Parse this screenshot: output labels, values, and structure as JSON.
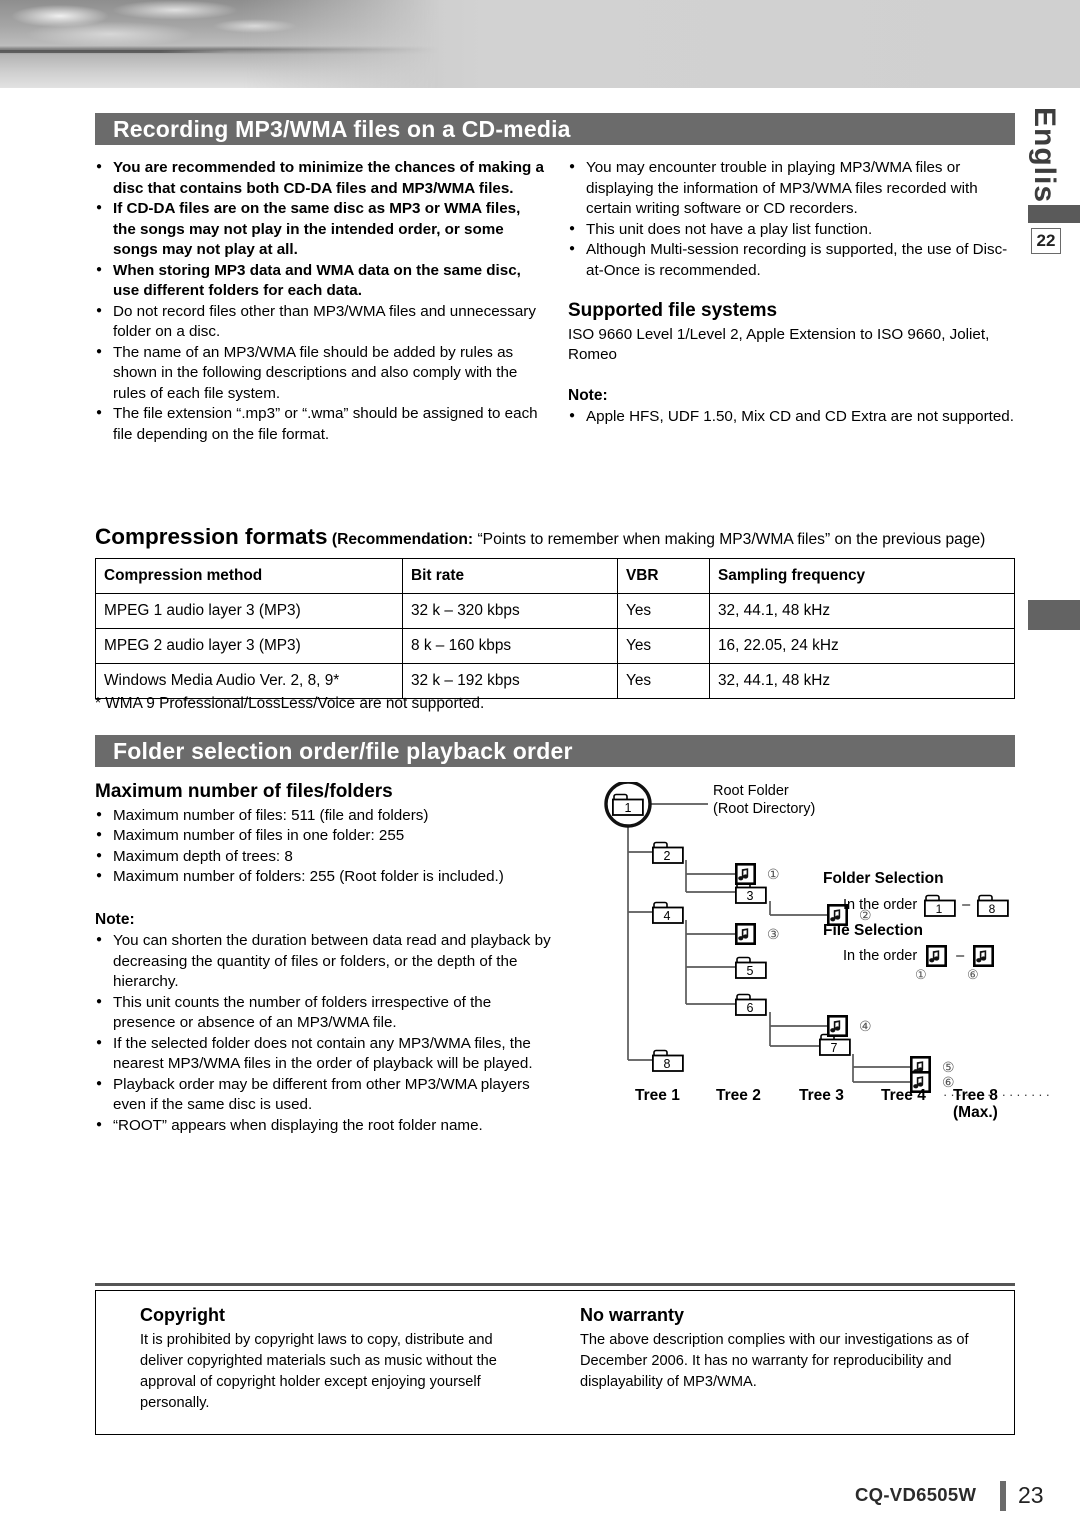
{
  "lang_tab": {
    "label": "English",
    "page_marker": "22"
  },
  "sections": {
    "recording": {
      "title": "Recording MP3/WMA files on a CD-media",
      "left_bullets": [
        {
          "bold": true,
          "text": "You are recommended to minimize the chances of making a disc that contains both CD-DA files and MP3/WMA files."
        },
        {
          "bold": true,
          "text": "If CD-DA files are on the same disc as MP3 or WMA files, the songs may not play in the intended order, or some songs may not play at all."
        },
        {
          "bold": true,
          "text": "When storing MP3 data and WMA data on the same disc, use different folders for each data."
        },
        {
          "bold": false,
          "text": "Do not record files other than MP3/WMA files and unnecessary folder on a disc."
        },
        {
          "bold": false,
          "text": "The name of an MP3/WMA file should be added by rules as shown in the following descriptions and also comply with the rules of each file system."
        },
        {
          "bold": false,
          "text": "The file extension “.mp3” or “.wma” should be assigned to each file depending on the file format."
        }
      ],
      "right_bullets": [
        "You may encounter trouble in playing MP3/WMA files or displaying the information of MP3/WMA files recorded with certain writing software or CD recorders.",
        "This unit does not have a play list function.",
        "Although Multi-session recording is supported, the use of Disc-at-Once is recommended."
      ],
      "supported_heading": "Supported file systems",
      "supported_body": "ISO 9660 Level 1/Level 2, Apple Extension to ISO 9660, Joliet, Romeo",
      "note_heading": "Note:",
      "note_bullets": [
        "Apple HFS, UDF 1.50, Mix CD and CD Extra are not supported."
      ]
    },
    "compression": {
      "heading_main": "Compression formats",
      "heading_sub_bold": "(Recommendation:",
      "heading_sub_rest": " “Points to remember when making MP3/WMA files” on the previous page)",
      "table": {
        "headers": [
          "Compression method",
          "Bit rate",
          "VBR",
          "Sampling frequency"
        ],
        "rows": [
          [
            "MPEG 1 audio layer 3 (MP3)",
            "32 k – 320 kbps",
            "Yes",
            "32, 44.1, 48 kHz"
          ],
          [
            "MPEG 2 audio layer 3 (MP3)",
            "8 k – 160 kbps",
            "Yes",
            "16, 22.05, 24 kHz"
          ],
          [
            "Windows Media Audio Ver. 2, 8, 9*",
            "32 k – 192 kbps",
            "Yes",
            "32, 44.1, 48 kHz"
          ]
        ]
      },
      "footnote": "* WMA 9 Professional/LossLess/Voice are not supported."
    },
    "folder": {
      "title": "Folder selection order/file playback order",
      "max_heading": "Maximum number of files/folders",
      "max_bullets": [
        "Maximum number of files: 511 (file and folders)",
        "Maximum number of files in one folder: 255",
        "Maximum depth of trees: 8",
        "Maximum number of folders: 255 (Root folder is included.)"
      ],
      "note_heading": "Note:",
      "note_bullets": [
        "You can shorten the duration between data read and playback by decreasing the quantity of files or folders, or the depth of the hierarchy.",
        "This unit counts the number of folders irrespective of the presence or absence of an MP3/WMA file.",
        "If the selected folder does not contain any MP3/WMA files, the nearest MP3/WMA files in the order of playback will be played.",
        "Playback order may be different from other MP3/WMA players even if the same disc is used.",
        "“ROOT” appears when displaying the root folder name."
      ],
      "diagram": {
        "root_label_line1": "Root Folder",
        "root_label_line2": "(Root Directory)",
        "folder_selection_heading": "Folder Selection",
        "folder_selection_text": "In the order",
        "folder_selection_from": "1",
        "folder_selection_dash": "–",
        "folder_selection_to": "8",
        "file_selection_heading": "File Selection",
        "file_selection_text": "In the order",
        "file_selection_from": "①",
        "file_selection_dash": "–",
        "file_selection_to": "⑥",
        "folders": [
          "1",
          "2",
          "3",
          "4",
          "5",
          "6",
          "7",
          "8"
        ],
        "files": [
          "①",
          "②",
          "③",
          "④",
          "⑤",
          "⑥"
        ],
        "tree_labels": [
          "Tree 1",
          "Tree 2",
          "Tree 3",
          "Tree 4",
          "Tree 8"
        ],
        "tree_max_note": "(Max.)",
        "dots": "···············"
      }
    }
  },
  "bottom": {
    "copyright_heading": "Copyright",
    "copyright_body": "It is prohibited by copyright laws to copy, distribute and deliver copyrighted materials such as music without the approval of copyright holder except enjoying yourself personally.",
    "warranty_heading": "No warranty",
    "warranty_body": "The above description complies with our investigations as of December 2006. It has no warranty for reproducibility and displayability of MP3/WMA."
  },
  "footer": {
    "model": "CQ-VD6505W",
    "page": "23"
  }
}
